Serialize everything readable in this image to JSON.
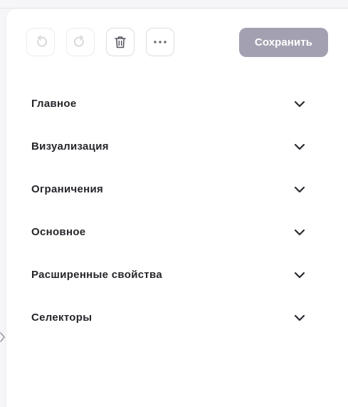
{
  "toolbar": {
    "undo_icon": "undo-icon",
    "redo_icon": "redo-icon",
    "delete_icon": "trash-icon",
    "more_icon": "more-horizontal-icon",
    "save_label": "Сохранить",
    "save_color": "#a3a1b1"
  },
  "sections": [
    {
      "label": "Главное",
      "icon": "chevron-down-icon"
    },
    {
      "label": "Визуализация",
      "icon": "chevron-down-icon"
    },
    {
      "label": "Ограничения",
      "icon": "chevron-down-icon"
    },
    {
      "label": "Основное",
      "icon": "chevron-down-icon"
    },
    {
      "label": "Расширенные свойства",
      "icon": "chevron-down-icon"
    },
    {
      "label": "Селекторы",
      "icon": "chevron-down-icon"
    }
  ]
}
